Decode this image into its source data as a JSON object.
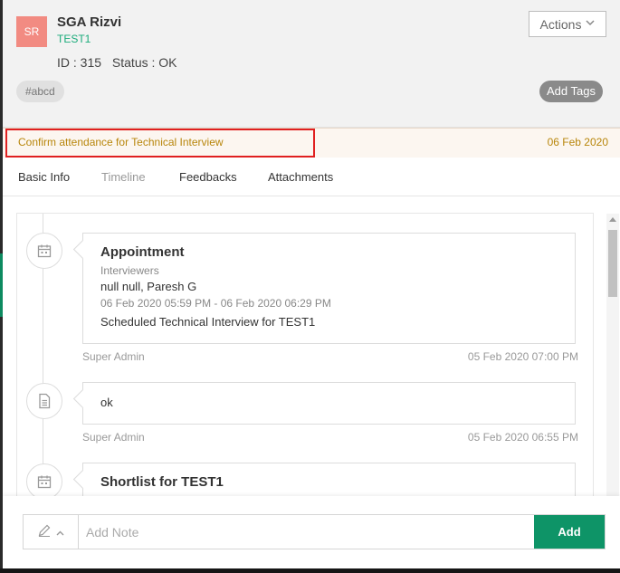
{
  "candidate": {
    "initials": "SR",
    "name": "SGA Rizvi",
    "subtitle": "TEST1",
    "id_text": "ID : 315",
    "status_text": "Status : OK",
    "tag": "#abcd"
  },
  "header": {
    "actions_label": "Actions",
    "add_tags_label": "Add Tags"
  },
  "task": {
    "text": "Confirm attendance for Technical Interview",
    "date": "06 Feb 2020"
  },
  "tabs": [
    "Basic Info",
    "Timeline",
    "Feedbacks",
    "Attachments"
  ],
  "timeline": [
    {
      "icon": "calendar-icon",
      "title": "Appointment",
      "label": "Interviewers",
      "people": "null null,  Paresh G",
      "time_range": "06 Feb 2020 05:59 PM - 06 Feb 2020 06:29 PM",
      "desc": "Scheduled Technical Interview for TEST1",
      "author": "Super Admin",
      "created": "05 Feb 2020 07:00 PM"
    },
    {
      "icon": "document-icon",
      "note": "ok",
      "author": "Super Admin",
      "created": "05 Feb 2020 06:55 PM"
    },
    {
      "icon": "calendar-icon",
      "title": "Shortlist for TEST1"
    }
  ],
  "note_bar": {
    "placeholder": "Add Note",
    "add_label": "Add"
  },
  "colors": {
    "accent_green": "#0e9467",
    "subtitle_green": "#1aab7a",
    "avatar_bg": "#f28b82",
    "banner_text": "#b8860b",
    "highlight_red": "#e02020"
  }
}
